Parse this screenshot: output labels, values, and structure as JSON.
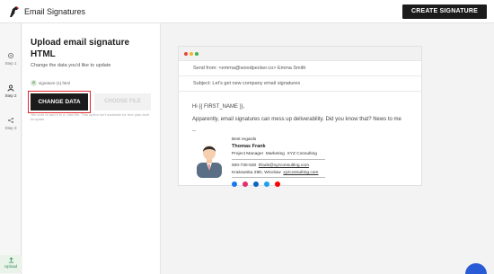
{
  "app": {
    "title": "Email Signatures",
    "create_button": "CREATE SIGNATURE"
  },
  "steps": [
    {
      "label": "Step 1",
      "icon": "gear-icon"
    },
    {
      "label": "Step 2",
      "icon": "person-icon"
    },
    {
      "label": "Step 3",
      "icon": "share-icon"
    }
  ],
  "upload": {
    "label": "Upload"
  },
  "panel": {
    "title": "Upload email signature HTML",
    "subtitle": "Change the data you'd like to update",
    "file_name": "signature (1).html",
    "change_button": "CHANGE DATA",
    "choose_button": "CHOOSE FILE",
    "note": "*Be sure to add it in a .html file. This option isn't available for free plan-built template"
  },
  "preview": {
    "from_label": "Send from:",
    "from_value": "<emma@woodpecker.co> Emma Smith",
    "subject_label": "Subject:",
    "subject_value": "Let's get new company email signatures",
    "greeting": "Hi {{ FIRST_NAME }},",
    "body": "Apparently, email signatures can mess up deliverability. Did you know that? News to me",
    "dashes": "--",
    "window_dot_colors": [
      "#e8453c",
      "#f3b22a",
      "#3cb54a"
    ]
  },
  "signature": {
    "regards": "Best regards",
    "name": "Thomas Frank",
    "role": "Project Manager",
    "dept": "Marketing",
    "company": "XYZ Consulting",
    "phone": "500-730-530",
    "email": "tfrank@xyzconsulting.com",
    "address": "Krakowska 29D, Wrocław",
    "website": "xyzconsulting.com",
    "social": [
      {
        "name": "facebook-icon",
        "color": "#1877f2"
      },
      {
        "name": "instagram-icon",
        "color": "#e1306c"
      },
      {
        "name": "linkedin-icon",
        "color": "#0a66c2"
      },
      {
        "name": "twitter-icon",
        "color": "#1da1f2"
      },
      {
        "name": "youtube-icon",
        "color": "#ff0000"
      }
    ]
  },
  "colors": {
    "accent_dark": "#1b1b1b",
    "highlight": "#e2262b",
    "chat": "#2a5bd7"
  }
}
